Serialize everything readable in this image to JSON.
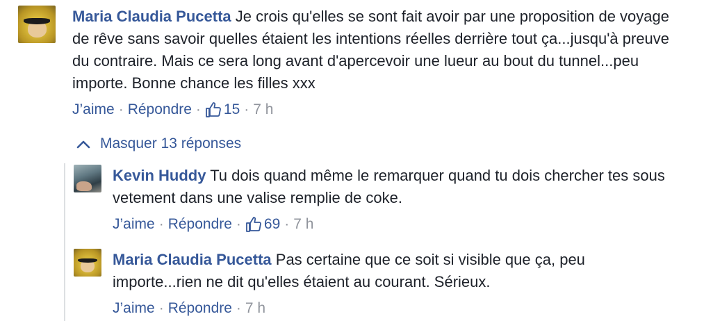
{
  "comments": {
    "c1": {
      "author": "Maria Claudia Pucetta",
      "text": "Je crois qu'elles se sont fait avoir par une proposition de voyage de rêve sans savoir quelles étaient les intentions réelles derrière tout ça...jusqu'à preuve du contraire. Mais ce sera long avant d'apercevoir une lueur au bout du tunnel...peu importe. Bonne chance les filles xxx",
      "like_label": "J’aime",
      "reply_label": "Répondre",
      "likes": "15",
      "time": "7 h"
    }
  },
  "replies_toggle": {
    "label": "Masquer 13 réponses"
  },
  "replies": {
    "r1": {
      "author": "Kevin Huddy",
      "text": "Tu dois quand même le remarquer quand tu dois chercher tes sous vetement dans une valise remplie de coke.",
      "like_label": "J’aime",
      "reply_label": "Répondre",
      "likes": "69",
      "time": "7 h"
    },
    "r2": {
      "author": "Maria Claudia Pucetta",
      "text": "Pas certaine que ce soit si visible que ça, peu importe...rien ne dit qu'elles étaient au courant. Sérieux.",
      "like_label": "J’aime",
      "reply_label": "Répondre",
      "time": "7 h"
    }
  },
  "colors": {
    "link": "#365899",
    "meta": "#90949c",
    "text": "#1d2129"
  },
  "icons": {
    "like": "thumbs-up-icon",
    "collapse": "chevron-up-icon"
  }
}
